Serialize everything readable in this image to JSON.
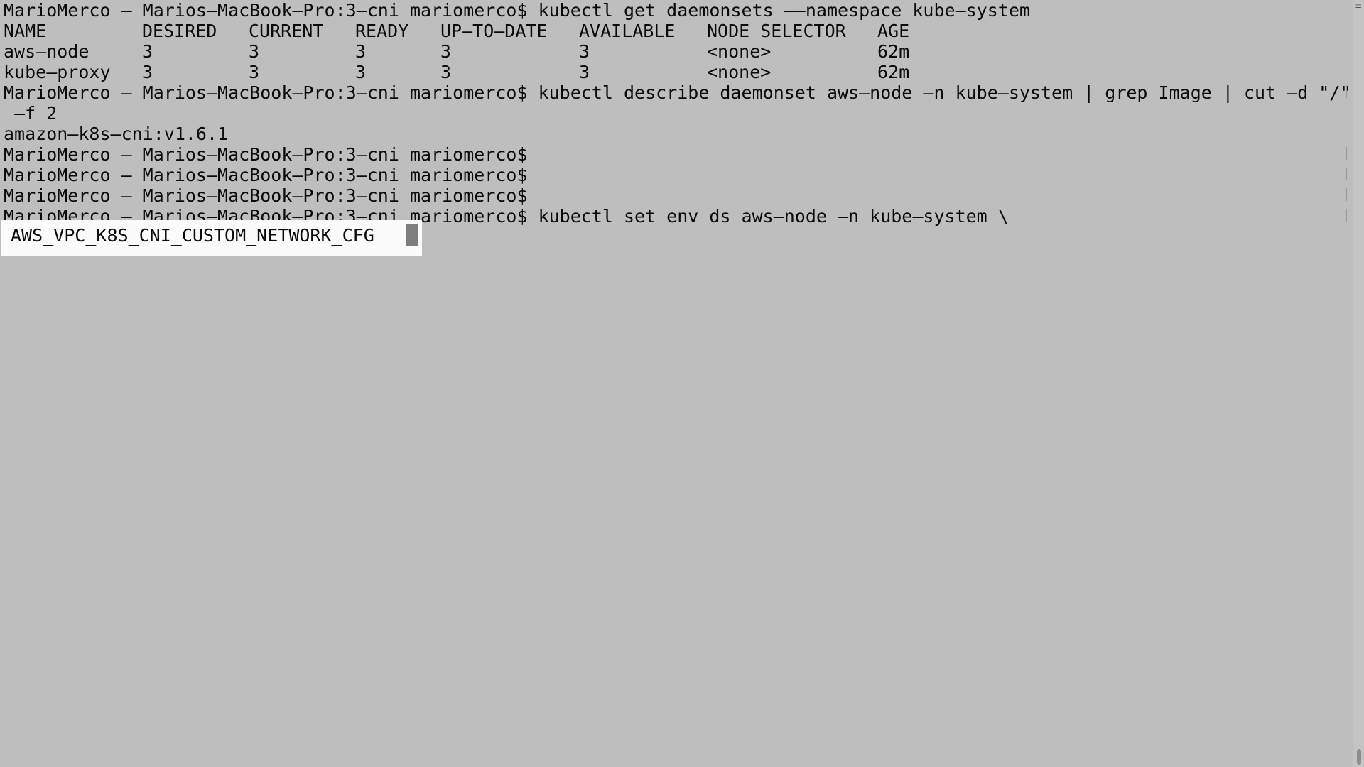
{
  "terminal": {
    "prompt": "MarioMerco – Marios–MacBook–Pro:3–cni mariomerco$",
    "lines": [
      {
        "text": "MarioMerco – Marios–MacBook–Pro:3–cni mariomerco$ kubectl get daemonsets ––namespace kube–system"
      },
      {
        "text": " –f 2"
      },
      {
        "text": "amazon–k8s–cni:v1.6.1"
      },
      {
        "text": "MarioMerco – Marios–MacBook–Pro:3–cni mariomerco$"
      },
      {
        "text": "MarioMerco – Marios–MacBook–Pro:3–cni mariomerco$"
      },
      {
        "text": "MarioMerco – Marios–MacBook–Pro:3–cni mariomerco$"
      },
      {
        "text": "MarioMerco – Marios–MacBook–Pro:3–cni mariomerco$ kubectl set env ds aws–node –n kube–system \\"
      }
    ],
    "describe_command": "MarioMerco – Marios–MacBook–Pro:3–cni mariomerco$ kubectl describe daemonset aws–node –n kube–system | grep Image | cut –d \"/\"",
    "table": {
      "headers": [
        "NAME",
        "DESIRED",
        "CURRENT",
        "READY",
        "UP–TO–DATE",
        "AVAILABLE",
        "NODE SELECTOR",
        "AGE"
      ],
      "rows": [
        [
          "aws–node",
          "3",
          "3",
          "3",
          "3",
          "3",
          "<none>",
          "62m"
        ],
        [
          "kube–proxy",
          "3",
          "3",
          "3",
          "3",
          "3",
          "<none>",
          "62m"
        ]
      ]
    },
    "current_input": "AWS_VPC_K8S_CNI_CUSTOM_NETWORK_CFG"
  },
  "icons": {
    "split_pane": "split-pane-icon"
  }
}
